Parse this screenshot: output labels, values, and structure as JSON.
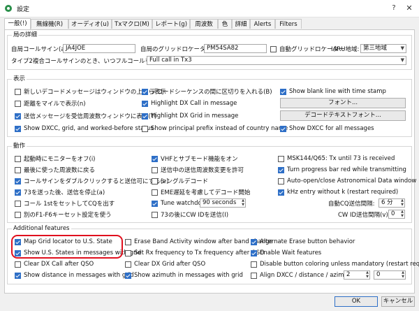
{
  "window": {
    "title": "設定",
    "help": "?",
    "close": "✕",
    "icon": "radio-app-icon"
  },
  "tabs": [
    "一般(!)",
    "無線機(R)",
    "オーディオ(u)",
    "Txマクロ(M)",
    "レポート(g)",
    "周波数",
    "色",
    "詳細",
    "Alerts",
    "Filters"
  ],
  "station": {
    "title": "局の詳細",
    "callsign_label": "自局コールサイン(a):",
    "callsign": "JA4JOE",
    "grid_label": "自局のグリッドロケーター(y):",
    "grid": "PM54SA82",
    "auto_grid_label": "自動グリッドロケーター",
    "iaru_label": "IARU地域:",
    "iaru_value": "第三地域",
    "type2_label": "タイプ2複合コールサインのとき、いつフルコールを送信するか:",
    "type2_value": "Full call in Tx3"
  },
  "display": {
    "title": "表示",
    "col1": [
      {
        "label": "新しいデコードメッセージはウィンドウの上から表示",
        "checked": false
      },
      {
        "label": "距離をマイルで表示(n)",
        "checked": false
      },
      {
        "label": "送信メッセージを受信周波数ウィンドウに表示(T)",
        "checked": true
      },
      {
        "label": "Show DXCC, grid, and worked-before status",
        "checked": true
      }
    ],
    "col2": [
      {
        "label": "デコードシーケンスの間に区切りを入れる(B)",
        "checked": true
      },
      {
        "label": "Highlight DX Call in message",
        "checked": true
      },
      {
        "label": "Highlight DX Grid in message",
        "checked": true
      },
      {
        "label": "Show principal prefix instead of country name",
        "checked": false
      }
    ],
    "col3_top": {
      "label": "Show blank line with time stamp",
      "checked": true
    },
    "font_button": "フォント...",
    "decode_font_button": "デコードテキストフォント...",
    "col3_bottom": {
      "label": "Show DXCC for all messages",
      "checked": true
    }
  },
  "behavior": {
    "title": "動作",
    "col1": [
      {
        "label": "起動時にモニターをオフ(i)",
        "checked": false
      },
      {
        "label": "最後に使った周波数に戻る",
        "checked": false
      },
      {
        "label": "コールサインをダブルクリックすると送信可にする(e)",
        "checked": true
      },
      {
        "label": "73を送った後、送信を停止(a)",
        "checked": true
      },
      {
        "label": "コール 1stをセットしてCQを出す",
        "checked": false
      },
      {
        "label": "別のF1-F6キーセット設定を使う",
        "checked": false
      }
    ],
    "col2": [
      {
        "label": "VHFとサブモード機能をオン",
        "checked": true
      },
      {
        "label": "送信中の送信周波数変更を許可",
        "checked": false
      },
      {
        "label": "シングルデコード",
        "checked": false
      },
      {
        "label": "EME遅延を考慮してデコード開始",
        "checked": false
      }
    ],
    "tune_watchdog": {
      "label": "Tune watchdog",
      "checked": true,
      "value": "90 seconds"
    },
    "cw_id_label": "73の後にCW IDを送信(I)",
    "col3": [
      {
        "label": "MSK144/Q65: Tx until 73 is received",
        "checked": false
      },
      {
        "label": "Turn progress bar red while transmitting",
        "checked": true
      },
      {
        "label": "Auto-open/close Astronomical Data window",
        "checked": false
      },
      {
        "label": "kHz entry without k (restart required)",
        "checked": true
      }
    ],
    "cq_interval_label": "自動CQ送信間隔:",
    "cq_interval_value": "6 分",
    "cw_interval_label": "CW ID送信間隔(v):",
    "cw_interval_value": "0"
  },
  "additional": {
    "title": "Additional features",
    "col1": [
      {
        "label": "Map Grid locator to U.S. State",
        "checked": true
      },
      {
        "label": "Show U.S. States in messages with grid",
        "checked": true
      },
      {
        "label": "Clear DX Call after QSO",
        "checked": false
      },
      {
        "label": "Show distance in messages with grid",
        "checked": true
      }
    ],
    "col2": [
      {
        "label": "Erase Band Activity window after band change",
        "checked": false
      },
      {
        "label": "Set Rx frequency to Tx frequency after QSO",
        "checked": false
      },
      {
        "label": "Clear DX Grid after QSO",
        "checked": false
      },
      {
        "label": "Show azimuth in messages with grid",
        "checked": true
      }
    ],
    "col3": [
      {
        "label": "Alternate Erase button behavior",
        "checked": true
      },
      {
        "label": "Enable Wait features",
        "checked": true
      },
      {
        "label": "Disable button coloring unless mandatory (restart required)",
        "checked": false
      }
    ],
    "align": {
      "label": "Align DXCC / distance / azimuth",
      "checked": false,
      "value1": "2",
      "value2": "0"
    }
  },
  "footer": {
    "ok": "OK",
    "cancel": "キャンセル"
  },
  "colors": {
    "accent": "#2e6fc7",
    "annotation": "#e0101e"
  }
}
